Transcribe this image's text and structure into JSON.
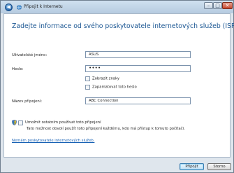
{
  "window": {
    "title": "Připojit k Internetu",
    "minimize_glyph": "–",
    "maximize_glyph": "□",
    "close_glyph": "✕",
    "back_glyph": "◀"
  },
  "main": {
    "heading": "Zadejte informace od svého poskytovatele internetových služeb (ISP).",
    "username_label": "Uživatelské jméno:",
    "username_value": "ASUS",
    "password_label": "Heslo:",
    "password_value": "••••",
    "show_chars_label": "Zobrazit znaky",
    "show_chars_checked": false,
    "remember_password_label": "Zapamatovat toto heslo",
    "remember_password_checked": false,
    "connection_name_label": "Název připojení:",
    "connection_name_value": "ABC Connection",
    "allow_others_label": "Umožnit ostatním používat toto připojení",
    "allow_others_checked": false,
    "allow_others_description": "Tato možnost dovolí použít toto připojení každému, kdo má přístup k tomuto počítači.",
    "no_isp_link": "Nemám poskytovatele internetových služeb."
  },
  "footer": {
    "connect_label": "Připojit",
    "cancel_label": "Storno"
  },
  "colors": {
    "heading": "#1c5793",
    "link": "#1660b4",
    "window_frame": "#dfe6ed"
  },
  "icons": {
    "back": "back-arrow-icon",
    "window": "network-icon",
    "shield": "uac-shield-icon"
  }
}
